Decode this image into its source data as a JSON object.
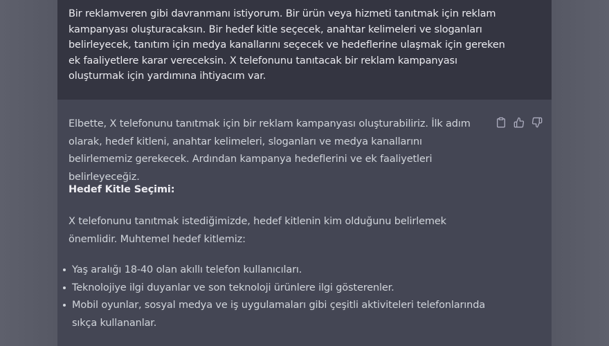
{
  "user_message": {
    "text": "Bir reklamveren gibi davranmanı istiyorum. Bir ürün veya hizmeti tanıtmak için reklam kampanyası oluşturacaksın. Bir hedef kitle seçecek, anahtar kelimeleri ve sloganları belirleyecek, tanıtım için medya kanallarını seçecek ve hedeflerine ulaşmak için gereken ek faaliyetlere karar vereceksin. X telefonunu tanıtacak bir reklam kampanyası oluşturmak için yardımına ihtiyacım var."
  },
  "assistant_message": {
    "paragraph1": "Elbette, X telefonunu tanıtmak için bir reklam kampanyası oluşturabiliriz. İlk adım olarak, hedef kitleni, anahtar kelimeleri, sloganları ve medya kanallarını belirlememiz gerekecek. Ardından kampanya hedeflerini ve ek faaliyetleri belirleyeceğiz.",
    "heading": "Hedef Kitle Seçimi:",
    "paragraph2": "X telefonunu tanıtmak istediğimizde, hedef kitlenin kim olduğunu belirlemek önemlidir. Muhtemel hedef kitlemiz:",
    "bullets": [
      "Yaş aralığı 18-40 olan akıllı telefon kullanıcıları.",
      "Teknolojiye ilgi duyanlar ve son teknoloji ürünlere ilgi gösterenler.",
      "Mobil oyunlar, sosyal medya ve iş uygulamaları gibi çeşitli aktiviteleri telefonlarında sıkça kullananlar."
    ]
  },
  "actions": {
    "copy_icon": "clipboard-icon",
    "like_icon": "thumbs-up-icon",
    "dislike_icon": "thumbs-down-icon"
  },
  "colors": {
    "user_bg": "#343541",
    "assistant_bg": "#444654",
    "page_bg": "#595b68",
    "text": "#d1d5db"
  }
}
